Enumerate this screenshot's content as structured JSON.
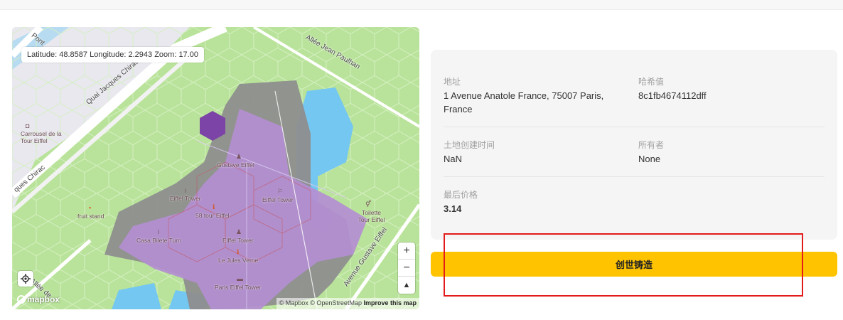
{
  "map": {
    "coords_text": "Latitude: 48.8587  Longitude: 2.2943  Zoom: 17.00",
    "streets": {
      "pont": "Pont",
      "quai": "Quai Jacques Chirac",
      "quai_lower": "ques Chirac",
      "allee_paulhan": "Allée Jean Paulhan",
      "av_eiffel": "Avenue Gustave Eiffel",
      "allee_deb": "Allée de"
    },
    "places": {
      "carrousel": "Carrousel de la Tour Eiffel",
      "gustave": "Gustave Eiffel",
      "eiffel_tower_1": "Eiffel Tower",
      "eiffel_tower_2": "Eiffel Tower",
      "fruit_stand": "fruit stand",
      "tour58": "58 tour Eiffel",
      "toilette": "Toilette Tour Eiffel",
      "casa": "Casa Bilete Turn",
      "eiffel_tower_3": "Eiffel Tower",
      "jules_verne": "Le Jules Verne",
      "paris_eiffel": "Paris Eiffel Tower"
    },
    "zoom_in": "+",
    "zoom_out": "−",
    "compass": "▲",
    "logo": "mapbox",
    "attribution": {
      "mapbox": "© Mapbox",
      "osm": "© OpenStreetMap",
      "improve": "Improve this map"
    }
  },
  "details": {
    "address_label": "地址",
    "address_value": "1 Avenue Anatole France, 75007 Paris, France",
    "hash_label": "哈希值",
    "hash_value": "8c1fb4674112dff",
    "created_label": "土地创建时间",
    "created_value": "NaN",
    "owner_label": "所有者",
    "owner_value": "None",
    "price_label": "最后价格",
    "price_value": "3.14"
  },
  "mint_button": "创世铸造",
  "colors": {
    "park_green": "#b9e39a",
    "water": "#74c7f0",
    "hex_gray": "#8e8e8e",
    "hex_purple": "#b48ed1",
    "hex_selected": "#7b44a6",
    "mint_yellow": "#ffc300",
    "highlight_red": "#e41b1b"
  }
}
